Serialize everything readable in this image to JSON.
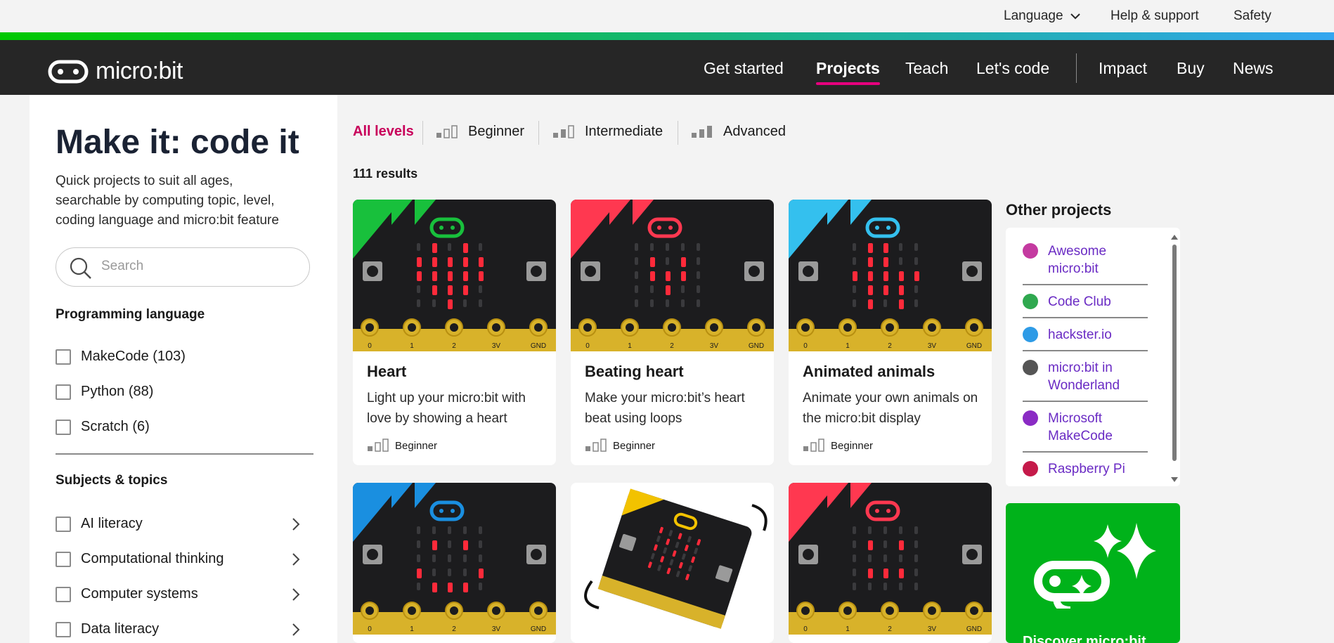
{
  "utility_nav": {
    "language": "Language",
    "help": "Help & support",
    "safety": "Safety"
  },
  "logo": {
    "text": "micro:bit"
  },
  "main_nav": {
    "items": [
      "Get started",
      "Projects",
      "Teach",
      "Let's code",
      "Impact",
      "Buy",
      "News"
    ],
    "active": "Projects"
  },
  "sidebar": {
    "title": "Make it: code it",
    "intro": "Quick projects to suit all ages, searchable by computing topic, level, coding language and micro:bit feature",
    "search_placeholder": "Search",
    "programming_heading": "Programming language",
    "languages": [
      "MakeCode (103)",
      "Python (88)",
      "Scratch (6)"
    ],
    "subjects_heading": "Subjects & topics",
    "subjects": [
      "AI literacy",
      "Computational thinking",
      "Computer systems",
      "Data literacy"
    ]
  },
  "levels": {
    "all": "All levels",
    "items": [
      "Beginner",
      "Intermediate",
      "Advanced"
    ]
  },
  "results": "111 results",
  "cards": [
    {
      "title": "Heart",
      "desc": "Light up your micro:bit with love by showing a heart",
      "level": "Beginner",
      "accent": "#18c03c"
    },
    {
      "title": "Beating heart",
      "desc": "Make your micro:bit’s heart beat using loops",
      "level": "Beginner",
      "accent": "#ff3850"
    },
    {
      "title": "Animated animals",
      "desc": "Animate your own animals on the micro:bit display",
      "level": "Beginner",
      "accent": "#34c0ee"
    }
  ],
  "row2_accents": [
    "#1a8fe0",
    "#f2c200",
    "#ff3850"
  ],
  "board_pins": [
    "0",
    "1",
    "2",
    "3V",
    "GND"
  ],
  "other_projects": {
    "title": "Other projects",
    "items": [
      {
        "label": "Awesome micro:bit",
        "color": "#c43aa0"
      },
      {
        "label": "Code Club",
        "color": "#2fa84f"
      },
      {
        "label": "hackster.io",
        "color": "#2e9be6"
      },
      {
        "label": "micro:bit in Wonderland",
        "color": "#555555"
      },
      {
        "label": "Microsoft MakeCode",
        "color": "#8a2bc4"
      },
      {
        "label": "Raspberry Pi",
        "color": "#c51a4a"
      }
    ]
  },
  "promo": {
    "text": "Discover micro:bit"
  }
}
